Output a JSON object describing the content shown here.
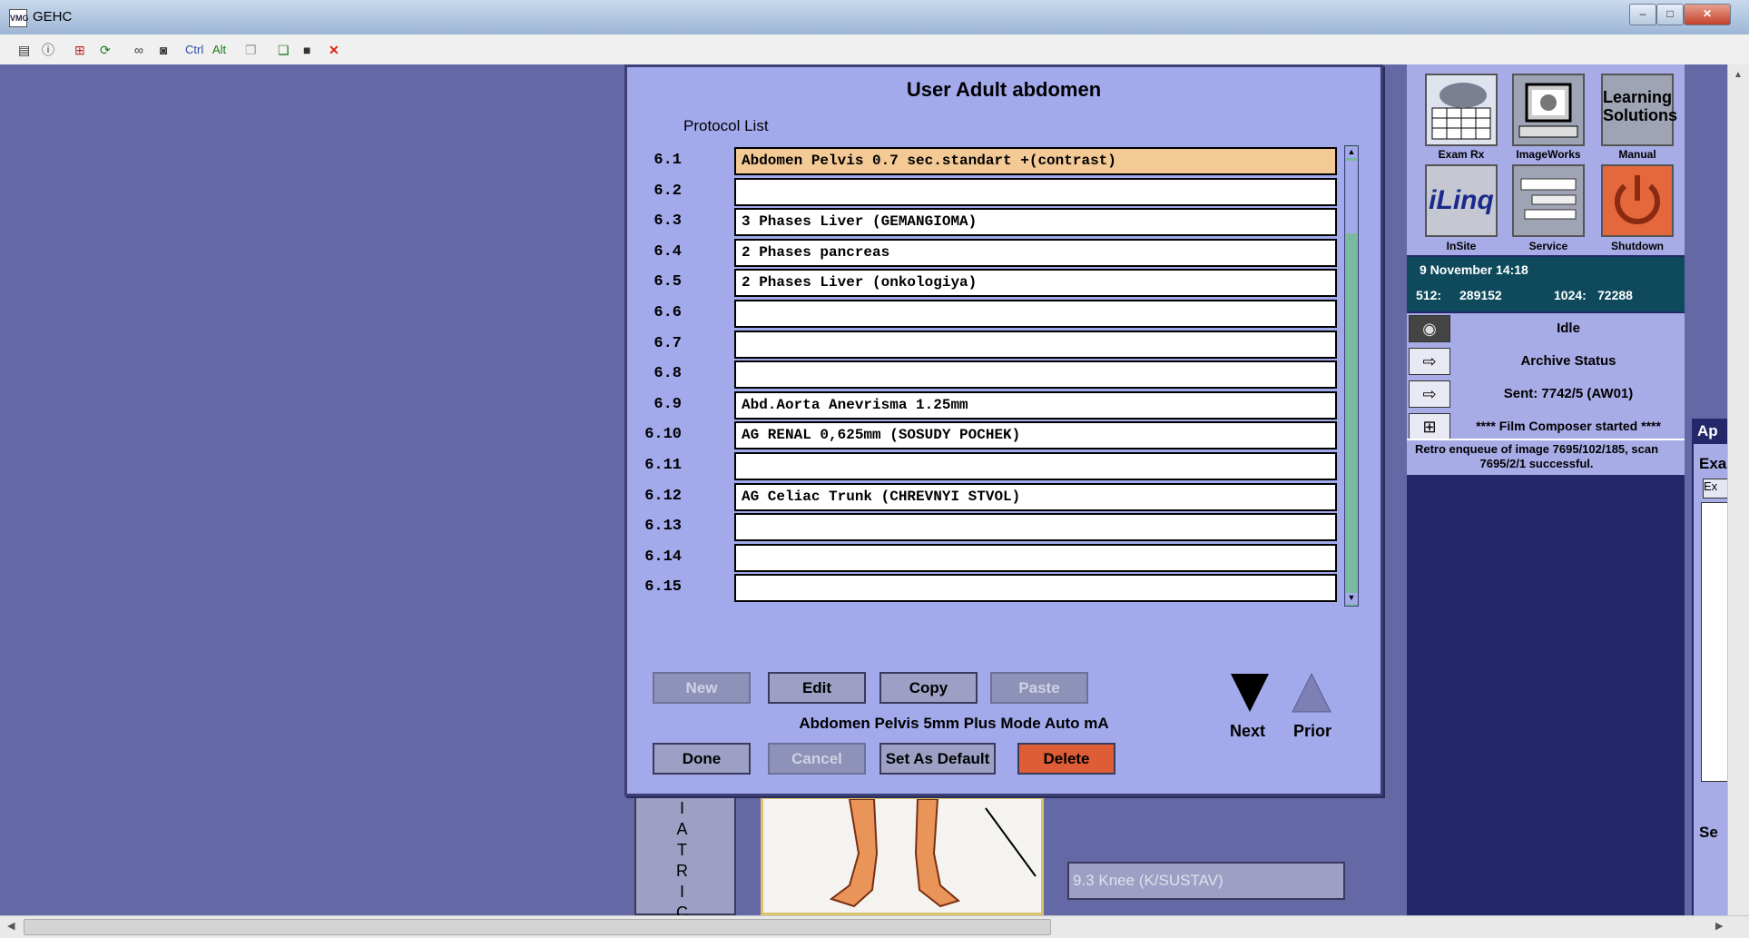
{
  "window": {
    "title": "GEHC",
    "app_icon": "VMG",
    "minimize": "–",
    "maximize": "□",
    "close": "✕"
  },
  "toolbar": {
    "icons": [
      "properties-icon",
      "info-icon",
      "grid-icon",
      "refresh-icon",
      "link-icon",
      "camera-icon",
      "ctrl-key",
      "alt-key",
      "copy-icon",
      "paste-icon",
      "save-icon",
      "close-icon"
    ],
    "ctrl": "Ctrl",
    "alt": "Alt"
  },
  "dialog": {
    "title": "User Adult abdomen",
    "subtitle": "Protocol List",
    "rows": [
      {
        "num": "6.1",
        "name": "Abdomen Pelvis 0.7 sec.standart +(contrast)"
      },
      {
        "num": "6.2",
        "name": ""
      },
      {
        "num": "6.3",
        "name": "3 Phases Liver (GEMANGIOMA)"
      },
      {
        "num": "6.4",
        "name": "2 Phases pancreas"
      },
      {
        "num": "6.5",
        "name": "2 Phases Liver (onkologiya)"
      },
      {
        "num": "6.6",
        "name": ""
      },
      {
        "num": "6.7",
        "name": ""
      },
      {
        "num": "6.8",
        "name": ""
      },
      {
        "num": "6.9",
        "name": "Abd.Aorta Anevrisma 1.25mm"
      },
      {
        "num": "6.10",
        "name": "AG RENAL  0,625mm (SOSUDY POCHEK)"
      },
      {
        "num": "6.11",
        "name": ""
      },
      {
        "num": "6.12",
        "name": "AG Celiac Trunk (CHREVNYI STVOL)"
      },
      {
        "num": "6.13",
        "name": ""
      },
      {
        "num": "6.14",
        "name": ""
      },
      {
        "num": "6.15",
        "name": ""
      }
    ],
    "buttons": {
      "new": "New",
      "edit": "Edit",
      "copy": "Copy",
      "paste": "Paste",
      "done": "Done",
      "cancel": "Cancel",
      "set_default": "Set As Default",
      "delete": "Delete"
    },
    "default_protocol": "Abdomen Pelvis 5mm Plus Mode Auto mA",
    "next": "Next",
    "prior": "Prior"
  },
  "right_panel": {
    "tiles": [
      {
        "label": "Exam Rx"
      },
      {
        "label": "ImageWorks"
      },
      {
        "label": "Manual",
        "text": "Learning Solutions"
      },
      {
        "label": "InSite",
        "text": "iLinq"
      },
      {
        "label": "Service"
      },
      {
        "label": "Shutdown"
      }
    ],
    "datetime": "9 November 14:18",
    "mem_512_label": "512:",
    "mem_512": "289152",
    "mem_1024_label": "1024:",
    "mem_1024": "72288",
    "idle": "Idle",
    "archive": "Archive Status",
    "sent": "Sent:  7742/5 (AW01)",
    "film": "**** Film Composer started ****",
    "retro": "Retro enqueue of image 7695/102/185, scan 7695/2/1 successful."
  },
  "background": {
    "side_letters": [
      "I",
      "A",
      "T",
      "R",
      "I",
      "C"
    ],
    "knee_label": "9.3 Knee (K/SUSTAV)",
    "partial_labels": [
      "Ap",
      "Exa",
      "Ex",
      "Se"
    ]
  },
  "colors": {
    "dialog": "#a3aaec",
    "selected_row": "#f3c995",
    "delete": "#de5c36",
    "background": "#6468a4"
  }
}
